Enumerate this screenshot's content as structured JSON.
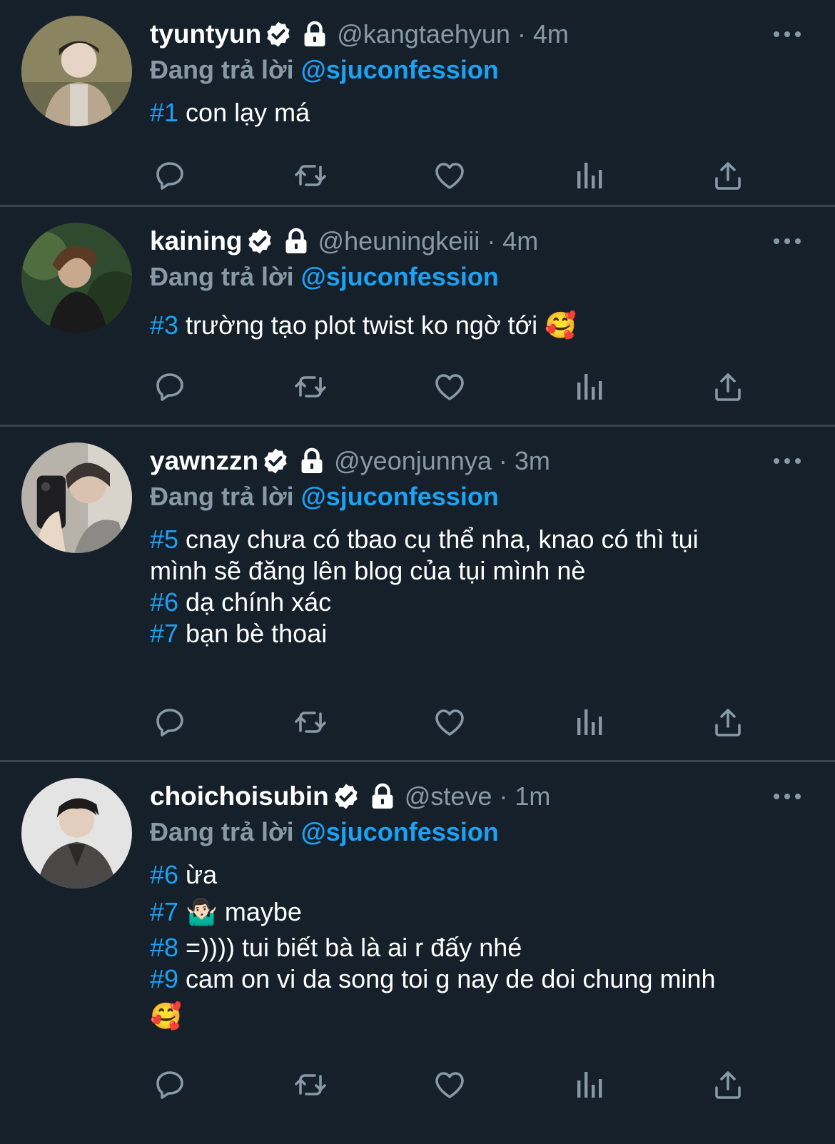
{
  "colors": {
    "background": "#15202b",
    "accent": "#1da1f2",
    "muted": "#8899a6",
    "divider": "#38444d"
  },
  "reply_prefix": "Đang trả lời",
  "tweets": [
    {
      "name": "tyuntyun",
      "handle": "@kangtaehyun",
      "time": "· 4m",
      "reply_to": "@sjuconfession",
      "lines": [
        {
          "tag": "#1",
          "text": " con lạy má"
        }
      ]
    },
    {
      "name": "kaining",
      "handle": "@heuningkeiii",
      "time": "· 4m",
      "reply_to": "@sjuconfession",
      "lines": [
        {
          "tag": "#3",
          "text": " trường tạo plot twist ko ngờ tới 🥰"
        }
      ]
    },
    {
      "name": "yawnzzn",
      "handle": "@yeonjunnya",
      "time": "· 3m",
      "reply_to": "@sjuconfession",
      "lines": [
        {
          "tag": "#5",
          "text": " cnay chưa có tbao cụ thể nha, knao có thì tụi"
        },
        {
          "tag": "",
          "text": "mình sẽ đăng lên blog của tụi mình nè"
        },
        {
          "tag": "#6",
          "text": " dạ chính xác"
        },
        {
          "tag": "#7",
          "text": " bạn bè thoai"
        }
      ]
    },
    {
      "name": "choichoisubin",
      "handle": "@steve",
      "time": "· 1m",
      "reply_to": "@sjuconfession",
      "lines": [
        {
          "tag": "#6",
          "text": " ừa"
        },
        {
          "tag": "#7",
          "text": " 🤷🏻‍♂️ maybe"
        },
        {
          "tag": "#8",
          "text": " =)))) tui biết bà là ai r đấy nhé"
        },
        {
          "tag": "#9",
          "text": " cam on vi da song toi g nay de doi chung minh"
        },
        {
          "tag": "",
          "text": "🥰"
        }
      ]
    }
  ],
  "icons": {
    "reply": "reply-icon",
    "retweet": "retweet-icon",
    "like": "like-icon",
    "analytics": "analytics-icon",
    "share": "share-icon",
    "more": "more-icon",
    "verified": "verified-icon",
    "lock": "lock-icon"
  }
}
